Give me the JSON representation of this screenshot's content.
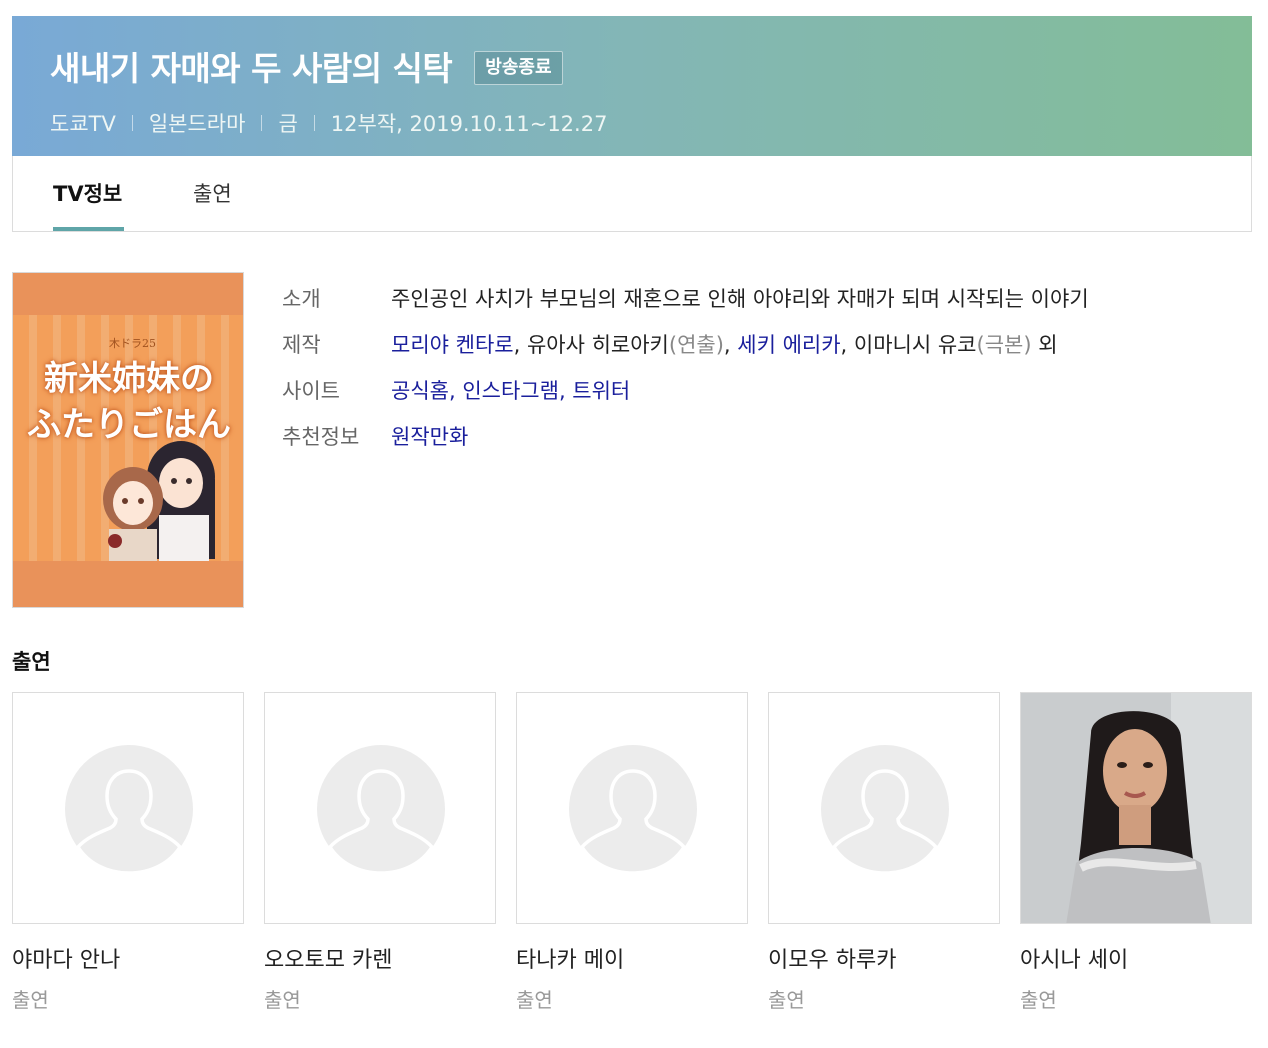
{
  "program": {
    "title": "새내기 자매와 두 사람의 식탁",
    "status_badge": "방송종료",
    "channel": "도쿄TV",
    "genre": "일본드라마",
    "day": "금",
    "episodes_dates": "12부작, 2019.10.11~12.27"
  },
  "tabs": [
    {
      "label": "TV정보",
      "active": true
    },
    {
      "label": "출연",
      "active": false
    }
  ],
  "poster": {
    "badge": "木ドラ25",
    "line1": "新米姉妹の",
    "line2": "ふたりごはん",
    "bg_color": "#e9925a"
  },
  "info": {
    "intro": {
      "label": "소개",
      "text": "주인공인 사치가 부모님의 재혼으로 인해 아야리와 자매가 되며 시작되는 이야기"
    },
    "production": {
      "label": "제작",
      "p1": "모리야 켄타로",
      "sep1": ", 유아사 히로아키",
      "role1": "(연출)",
      "sep2": ", ",
      "p2": "세키 에리카",
      "sep3": ", 이마니시 유코",
      "role2": "(극본)",
      "tail": " 외"
    },
    "site": {
      "label": "사이트",
      "links": [
        "공식홈",
        "인스타그램",
        "트위터"
      ]
    },
    "recommend": {
      "label": "추천정보",
      "link": "원작만화"
    }
  },
  "cast_section": {
    "title": "출연",
    "members": [
      {
        "name": "야마다 안나",
        "role": "출연",
        "photo": "placeholder"
      },
      {
        "name": "오오토모 카렌",
        "role": "출연",
        "photo": "placeholder"
      },
      {
        "name": "타나카 메이",
        "role": "출연",
        "photo": "placeholder"
      },
      {
        "name": "이모우 하루카",
        "role": "출연",
        "photo": "placeholder"
      },
      {
        "name": "아시나 세이",
        "role": "출연",
        "photo": "portrait"
      }
    ]
  },
  "colors": {
    "header_start": "#79a9d6",
    "header_end": "#83bd97",
    "tab_accent": "#5fa5a8",
    "link": "#1a1f9c"
  }
}
